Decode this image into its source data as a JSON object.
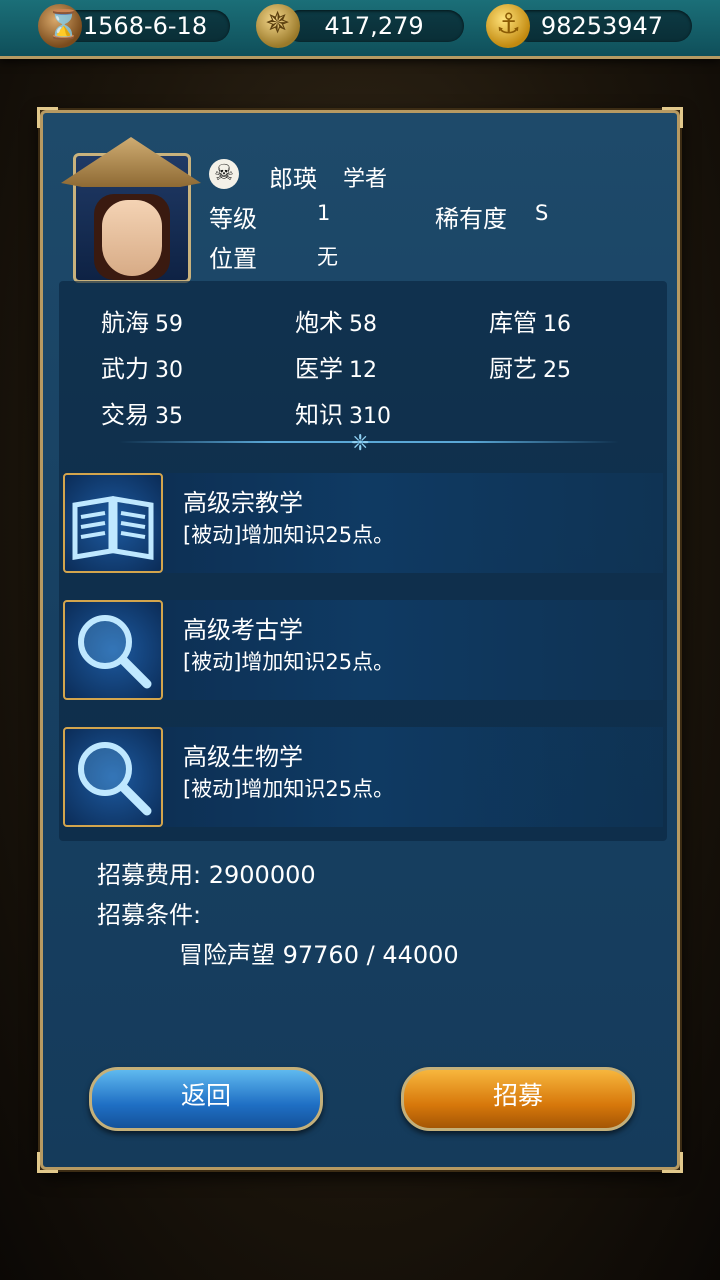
{
  "top_bar": {
    "date": "1568-6-18",
    "compass_value": "417,279",
    "gold": "98253947"
  },
  "character": {
    "name": "郎瑛",
    "title": "学者",
    "level_label": "等级",
    "level": "1",
    "rarity_label": "稀有度",
    "rarity": "S",
    "position_label": "位置",
    "position": "无"
  },
  "stats": [
    {
      "label": "航海",
      "value": "59"
    },
    {
      "label": "炮术",
      "value": "58"
    },
    {
      "label": "库管",
      "value": "16"
    },
    {
      "label": "武力",
      "value": "30"
    },
    {
      "label": "医学",
      "value": "12"
    },
    {
      "label": "厨艺",
      "value": "25"
    },
    {
      "label": "交易",
      "value": "35"
    },
    {
      "label": "知识",
      "value": "310"
    }
  ],
  "skills": [
    {
      "name": "高级宗教学",
      "desc": "[被动]增加知识25点。",
      "icon": "book-icon"
    },
    {
      "name": "高级考古学",
      "desc": "[被动]增加知识25点。",
      "icon": "magnifier-icon"
    },
    {
      "name": "高级生物学",
      "desc": "[被动]增加知识25点。",
      "icon": "magnifier-icon"
    }
  ],
  "recruit": {
    "cost_label": "招募费用:",
    "cost": "2900000",
    "condition_label": "招募条件:",
    "condition": "冒险声望 97760 / 44000"
  },
  "buttons": {
    "back": "返回",
    "recruit": "招募"
  }
}
